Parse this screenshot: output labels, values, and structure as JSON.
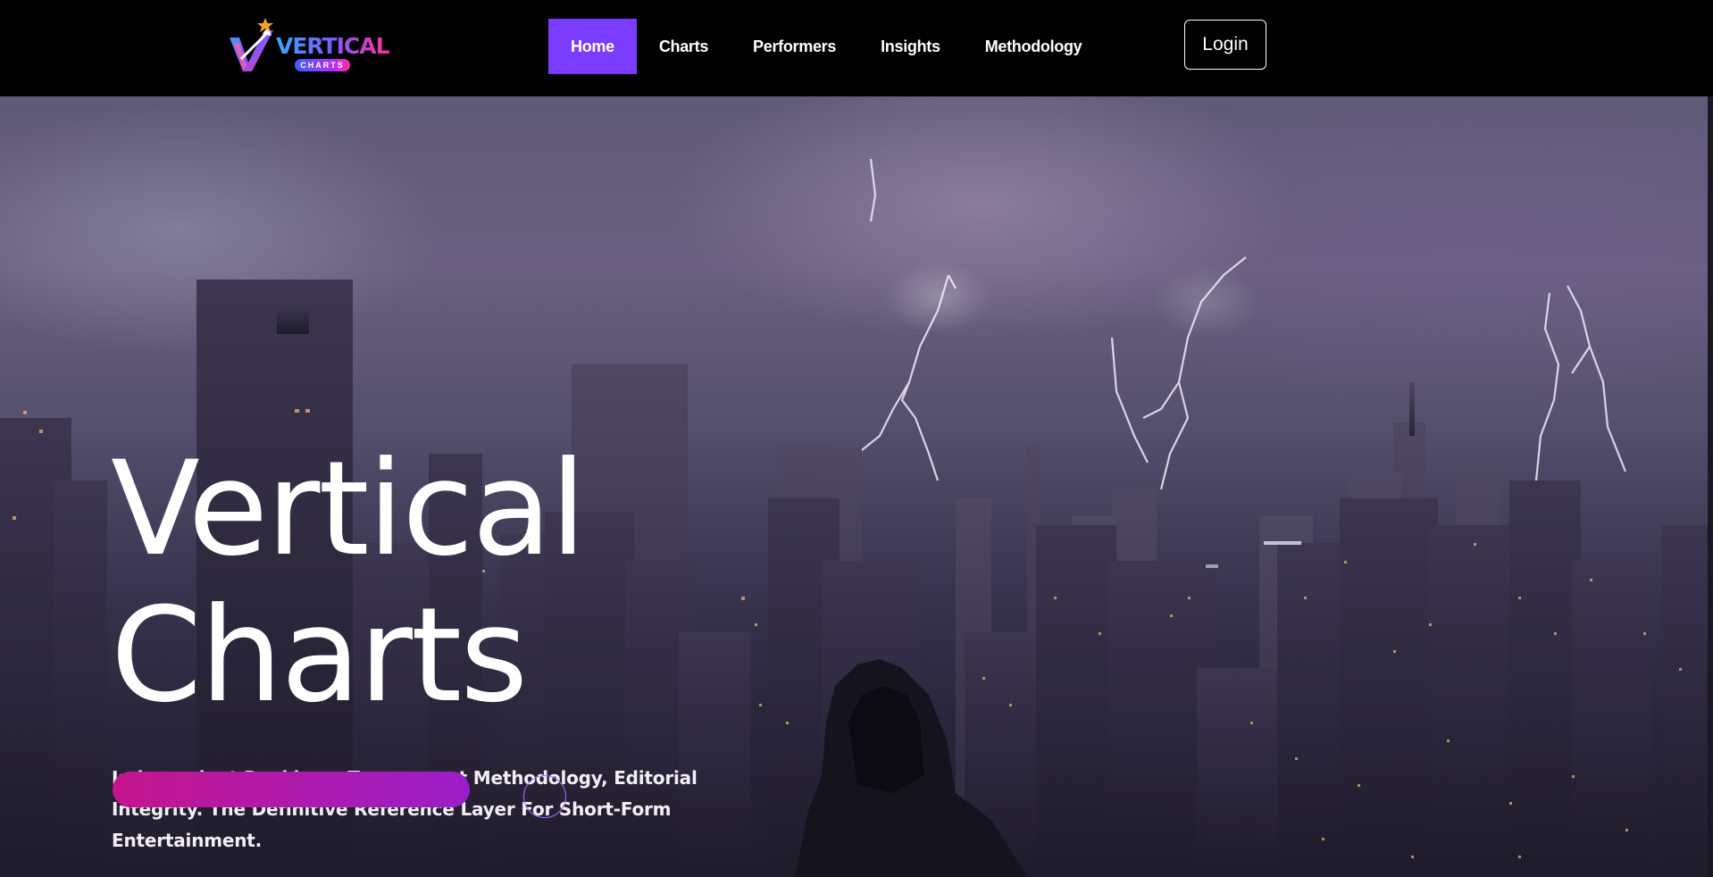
{
  "brand": {
    "name": "VERTICAL",
    "tagline": "CHARTS",
    "colors": {
      "accent": "#7a3cff",
      "pink": "#ff2e9b",
      "blue": "#37a6ff",
      "star": "#f5a524"
    }
  },
  "nav": {
    "items": [
      {
        "label": "Home",
        "active": true
      },
      {
        "label": "Charts",
        "active": false
      },
      {
        "label": "Performers",
        "active": false
      },
      {
        "label": "Insights",
        "active": false
      },
      {
        "label": "Methodology",
        "active": false
      }
    ],
    "login_label": "Login"
  },
  "hero": {
    "title_line1": "Vertical",
    "title_line2": "Charts",
    "subtitle": "Independent Rankings, Transparent Methodology, Editorial Integrity. The Definitive Reference Layer For Short-Form Entertainment.",
    "background": "stormy-city-skyline-with-lightning-and-hooded-figure"
  }
}
